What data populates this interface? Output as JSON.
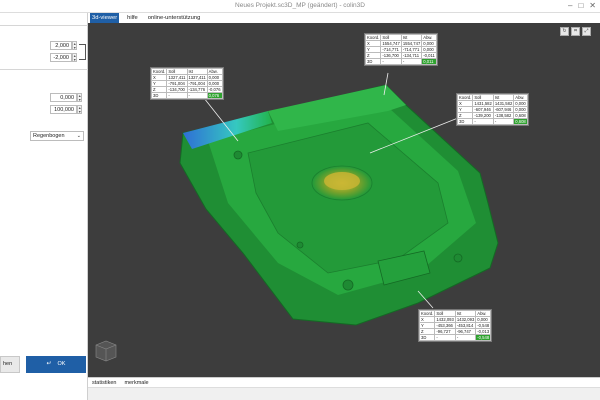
{
  "window": {
    "title": "Neues Projekt.sc3D_MP (geändert) - colin3D"
  },
  "left_panel": {
    "field1": "2,000",
    "field2": "-2,000",
    "field3": "0,000",
    "field4": "100,000",
    "colormap": "Regenbogen",
    "partial_button": "hen",
    "ok_button": "OK"
  },
  "tabs": [
    "3d-viewer",
    "hilfe",
    "online-unterstützung"
  ],
  "bottom_tabs": [
    "statistiken",
    "merkmale"
  ],
  "callouts": [
    {
      "headers": [
        "Koord.",
        "Soll",
        "Ist",
        "Abw."
      ],
      "rows": [
        [
          "X",
          "1327,411",
          "1327,411",
          "0,000"
        ],
        [
          "Y",
          "-791,004",
          "-791,004",
          "0,000"
        ],
        [
          "Z",
          "-134,700",
          "-134,776",
          "-0,076"
        ],
        [
          "3D",
          "-",
          "-",
          "0,076"
        ]
      ]
    },
    {
      "headers": [
        "Koord.",
        "Soll",
        "Ist",
        "Abw."
      ],
      "rows": [
        [
          "X",
          "1554,747",
          "1554,747",
          "0,000"
        ],
        [
          "Y",
          "-714,771",
          "-714,771",
          "0,000"
        ],
        [
          "Z",
          "-136,700",
          "-134,711",
          "-0,011"
        ],
        [
          "3D",
          "-",
          "-",
          "0,011"
        ]
      ]
    },
    {
      "headers": [
        "Koord.",
        "Soll",
        "Ist",
        "Abw."
      ],
      "rows": [
        [
          "X",
          "1431,582",
          "1431,582",
          "0,000"
        ],
        [
          "Y",
          "-607,946",
          "-607,946",
          "0,000"
        ],
        [
          "Z",
          "-139,200",
          "-138,582",
          "0,608"
        ],
        [
          "3D",
          "-",
          "-",
          "0,608"
        ]
      ]
    },
    {
      "headers": [
        "Koord.",
        "Soll",
        "Ist",
        "Abw."
      ],
      "rows": [
        [
          "X",
          "1432,093",
          "1432,093",
          "0,000"
        ],
        [
          "Y",
          "-453,366",
          "-453,814",
          "-0,548"
        ],
        [
          "Z",
          "-96,727",
          "-96,747",
          "-0,013"
        ],
        [
          "3D",
          "-",
          "-",
          "-0,548"
        ]
      ]
    }
  ],
  "icons": [
    "minimize-icon",
    "maximize-icon",
    "close-icon",
    "view-cube-icon",
    "ok-check-icon"
  ]
}
